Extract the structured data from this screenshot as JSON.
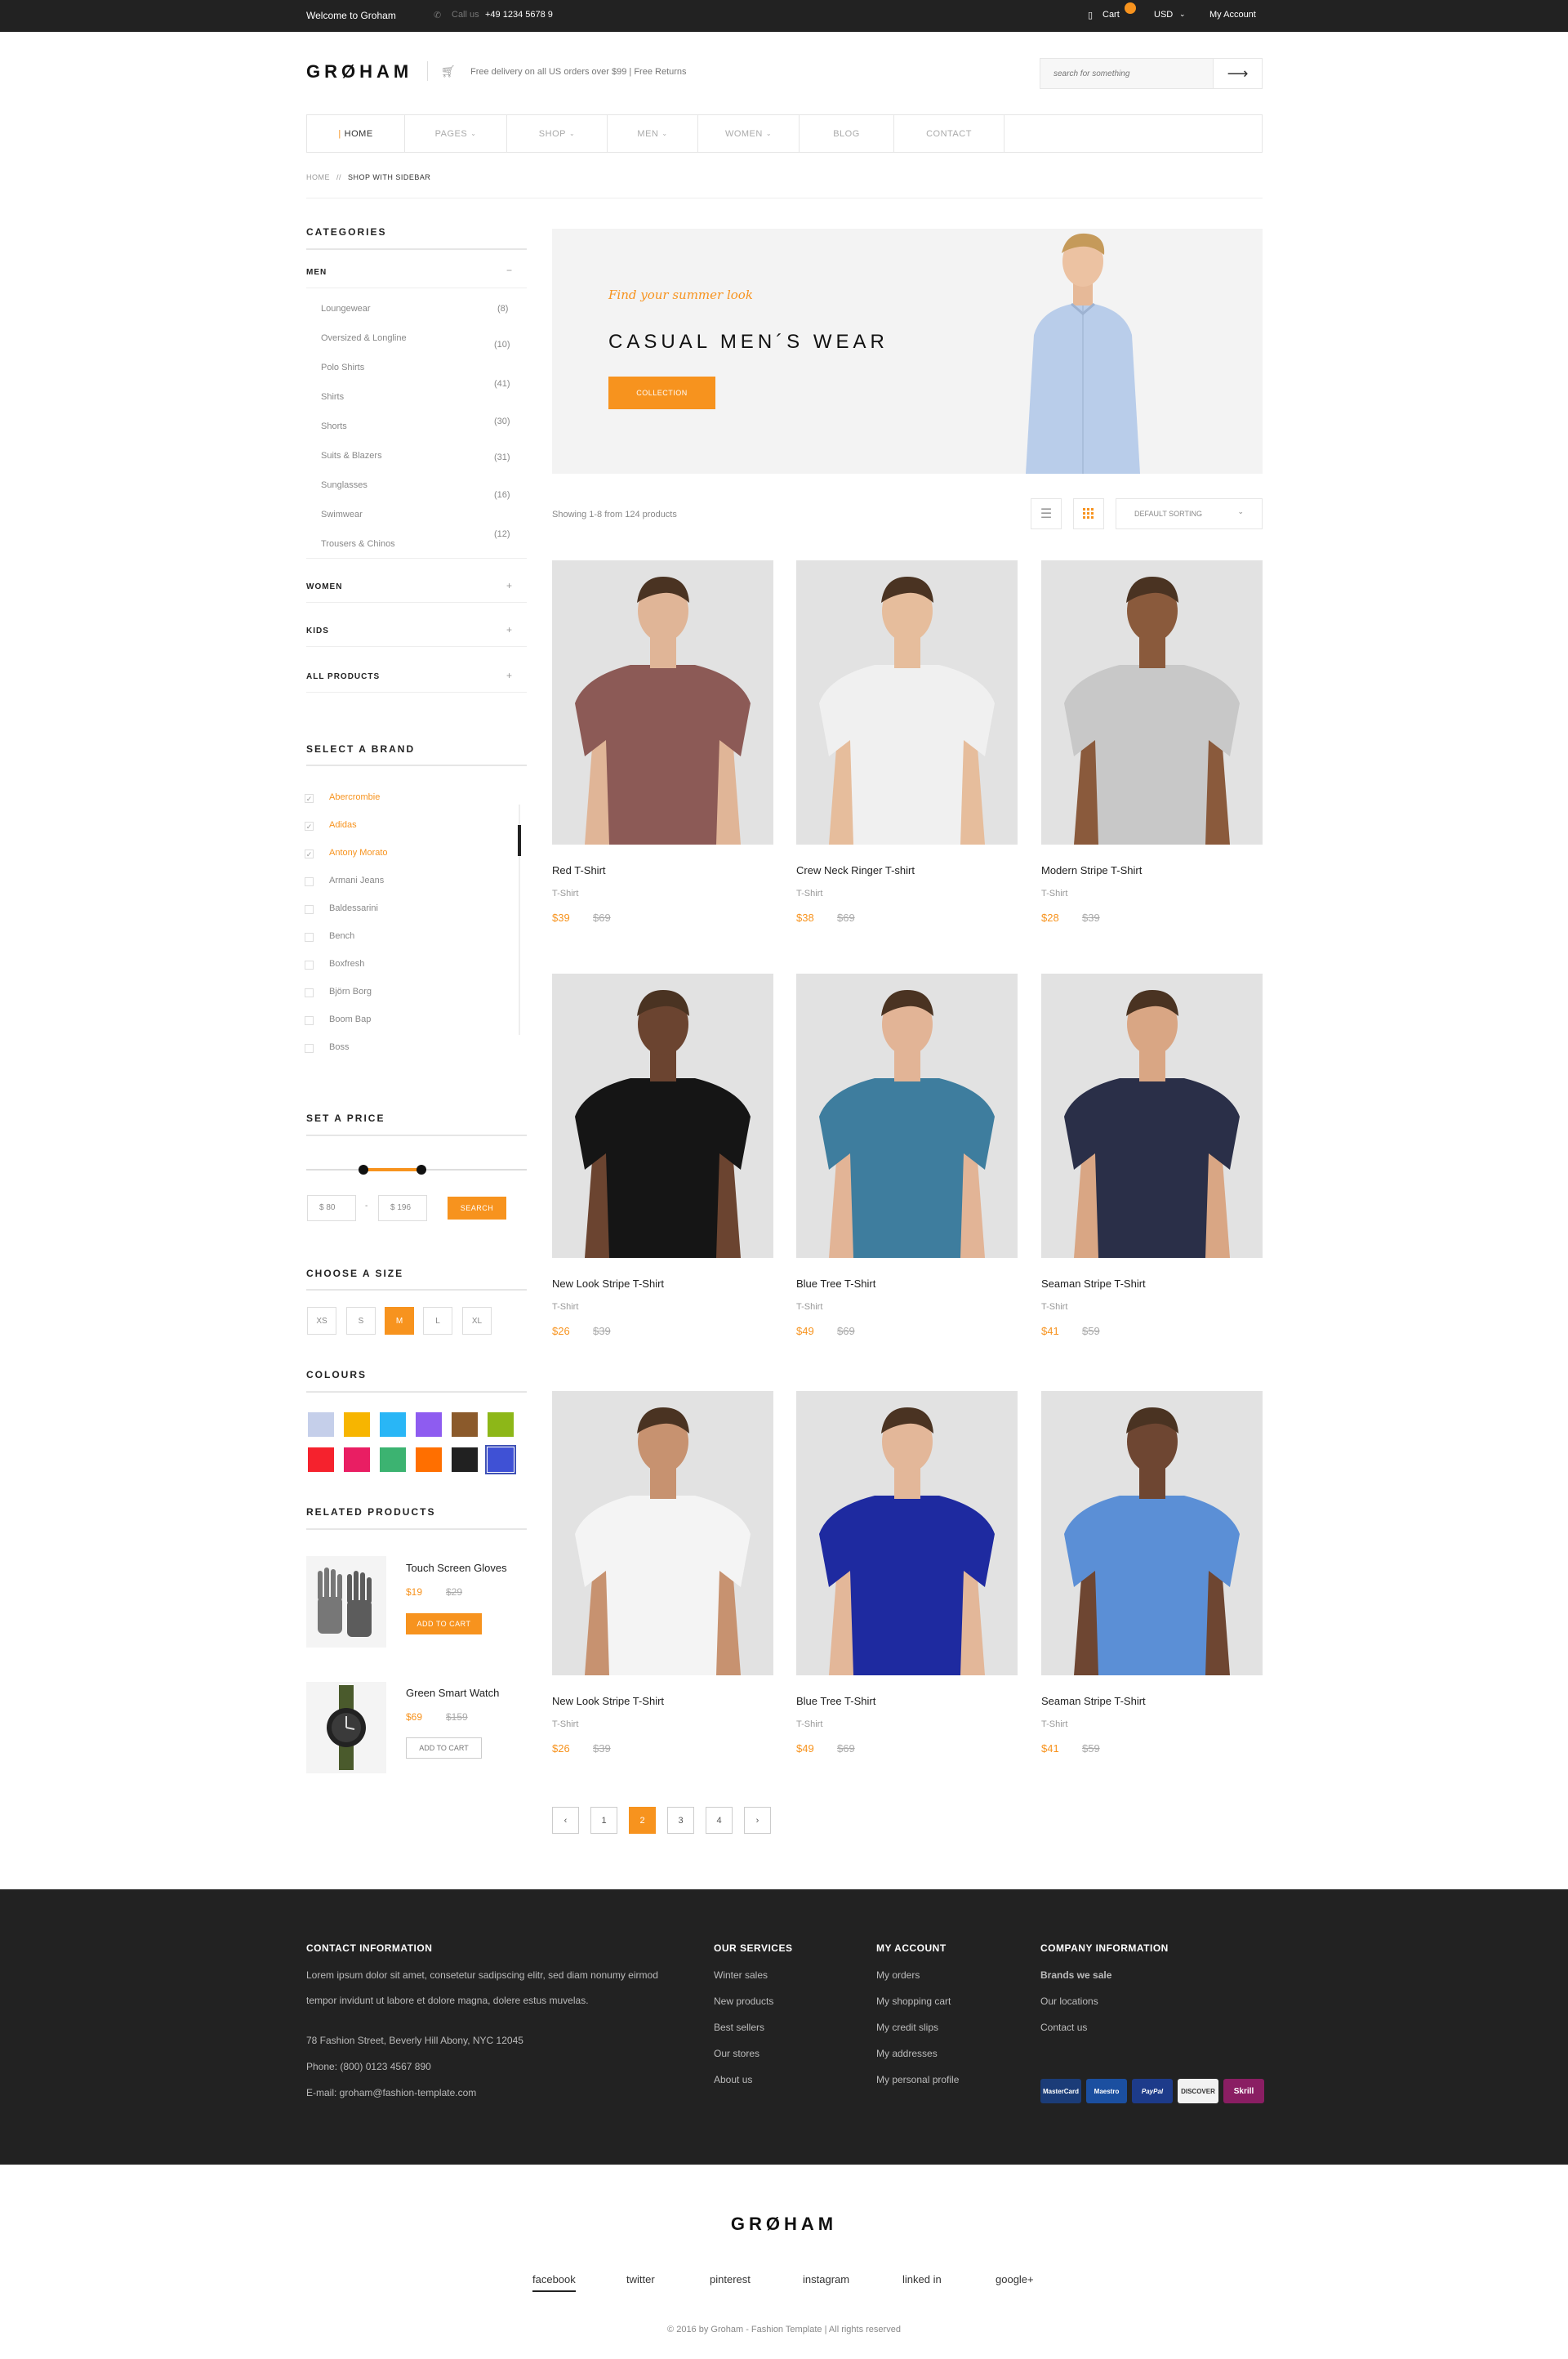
{
  "topbar": {
    "welcome": "Welcome to Groham",
    "call_label": "Call us",
    "phone": "+49 1234 5678 9",
    "cart": "Cart",
    "currency": "USD",
    "account": "My Account"
  },
  "header": {
    "logo": "GRØHAM",
    "delivery": "Free delivery on all US orders over $99 | Free Returns",
    "search_placeholder": "search for something"
  },
  "nav": {
    "items": [
      {
        "label": "HOME"
      },
      {
        "label": "PAGES"
      },
      {
        "label": "SHOP"
      },
      {
        "label": "MEN"
      },
      {
        "label": "WOMEN"
      },
      {
        "label": "BLOG"
      },
      {
        "label": "CONTACT"
      }
    ]
  },
  "breadcrumb": {
    "home": "HOME",
    "sep": "//",
    "current": "SHOP WITH SIDEBAR"
  },
  "sidebar": {
    "categories_title": "CATEGORIES",
    "men": "MEN",
    "men_toggle": "−",
    "subcats": [
      {
        "label": "Loungewear",
        "count": "(8)"
      },
      {
        "label": "Oversized & Longline",
        "count": "(10)"
      },
      {
        "label": "Polo Shirts",
        "count": "(41)"
      },
      {
        "label": "Shirts",
        "count": "(30)"
      },
      {
        "label": "Shorts",
        "count": "(31)"
      },
      {
        "label": "Suits & Blazers",
        "count": "(16)"
      },
      {
        "label": "Sunglasses",
        "count": "(12)"
      },
      {
        "label": "Swimwear",
        "count": ""
      },
      {
        "label": "Trousers & Chinos",
        "count": ""
      }
    ],
    "women": "WOMEN",
    "kids": "KIDS",
    "all_products": "ALL PRODUCTS",
    "plus": "+",
    "brand_title": "SELECT A BRAND",
    "brands": [
      {
        "label": "Abercrombie",
        "checked": "✓"
      },
      {
        "label": "Adidas",
        "checked": "✓"
      },
      {
        "label": "Antony Morato",
        "checked": "✓"
      },
      {
        "label": "Armani Jeans",
        "checked": ""
      },
      {
        "label": "Baldessarini",
        "checked": ""
      },
      {
        "label": "Bench",
        "checked": ""
      },
      {
        "label": "Boxfresh",
        "checked": ""
      },
      {
        "label": "Björn Borg",
        "checked": ""
      },
      {
        "label": "Boom Bap",
        "checked": ""
      },
      {
        "label": "Boss",
        "checked": ""
      }
    ],
    "price_title": "SET A PRICE",
    "price_min": "$  80",
    "price_dash": "-",
    "price_max": "$  196",
    "price_search": "SEARCH",
    "size_title": "CHOOSE A SIZE",
    "sizes": [
      "XS",
      "S",
      "M",
      "L",
      "XL"
    ],
    "colours_title": "COLOURS",
    "colours": [
      "#c5cfea",
      "#f7b500",
      "#29b6f6",
      "#8e5cf0",
      "#8b5a2b",
      "#8db718",
      "#f5222d",
      "#e91e63",
      "#3cb371",
      "#ff6f00",
      "#212121",
      "#3f51d5"
    ],
    "related_title": "RELATED PRODUCTS",
    "related": [
      {
        "name": "Touch Screen Gloves",
        "price": "$19",
        "old": "$29",
        "button": "ADD TO CART"
      },
      {
        "name": "Green Smart Watch",
        "price": "$69",
        "old": "$159",
        "button": "ADD TO CART"
      }
    ]
  },
  "banner": {
    "tagline": "Find your summer look",
    "title": "CASUAL MEN´S WEAR",
    "button": "COLLECTION"
  },
  "toolbar": {
    "showing": "Showing 1-8 from 124 products",
    "sorting": "DEFAULT SORTING"
  },
  "products": [
    {
      "name": "Red T-Shirt",
      "cat": "T-Shirt",
      "price": "$39",
      "old": "$69",
      "shirt": "#8c5a56",
      "skin": "#e0b597"
    },
    {
      "name": "Crew Neck Ringer T-shirt",
      "cat": "T-Shirt",
      "price": "$38",
      "old": "$69",
      "shirt": "#f0f0f0",
      "skin": "#e6bd9c"
    },
    {
      "name": "Modern Stripe T-Shirt",
      "cat": "T-Shirt",
      "price": "$28",
      "old": "$39",
      "shirt": "#c8c8c8",
      "skin": "#8a5a3c"
    },
    {
      "name": "New Look Stripe T-Shirt",
      "cat": "T-Shirt",
      "price": "$26",
      "old": "$39",
      "shirt": "#151515",
      "skin": "#6b4430"
    },
    {
      "name": "Blue Tree T-Shirt",
      "cat": "T-Shirt",
      "price": "$49",
      "old": "$69",
      "shirt": "#3e7d9e",
      "skin": "#e2b496"
    },
    {
      "name": "Seaman Stripe T-Shirt",
      "cat": "T-Shirt",
      "price": "$41",
      "old": "$59",
      "shirt": "#2a2f48",
      "skin": "#d9a684"
    },
    {
      "name": "New Look Stripe T-Shirt",
      "cat": "T-Shirt",
      "price": "$26",
      "old": "$39",
      "shirt": "#f4f4f4",
      "skin": "#c79270"
    },
    {
      "name": "Blue Tree T-Shirt",
      "cat": "T-Shirt",
      "price": "$49",
      "old": "$69",
      "shirt": "#1e2aa0",
      "skin": "#e3b799"
    },
    {
      "name": "Seaman Stripe T-Shirt",
      "cat": "T-Shirt",
      "price": "$41",
      "old": "$59",
      "shirt": "#5b8fd6",
      "skin": "#6e4632"
    }
  ],
  "pagination": {
    "prev": "‹",
    "pages": [
      "1",
      "2",
      "3",
      "4"
    ],
    "next": "›"
  },
  "footer": {
    "contact_title": "CONTACT INFORMATION",
    "contact_text1": "Lorem ipsum dolor sit amet, consetetur sadipscing elitr, sed diam nonumy eirmod",
    "contact_text2": "tempor invidunt ut labore et dolore magna, dolere estus muvelas.",
    "address": "78 Fashion Street, Beverly Hill Abony, NYC 12045",
    "phone": "Phone: (800) 0123 4567 890",
    "email": "E-mail:  groham@fashion-template.com",
    "services_title": "OUR SERVICES",
    "services": [
      "Winter sales",
      "New products",
      "Best sellers",
      "Our stores",
      "About us"
    ],
    "account_title": "MY ACCOUNT",
    "account": [
      "My orders",
      "My shopping cart",
      "My credit slips",
      "My addresses",
      "My personal profile"
    ],
    "company_title": "COMPANY INFORMATION",
    "company": [
      "Brands we sale",
      "Our locations",
      "Contact us"
    ],
    "payments": [
      "MasterCard",
      "Maestro",
      "PayPal",
      "DISCOVER",
      "Skrill"
    ]
  },
  "bottom": {
    "logo": "GRØHAM",
    "social": [
      "facebook",
      "twitter",
      "pinterest",
      "instagram",
      "linked in",
      "google+"
    ],
    "copyright": "© 2016 by Groham - Fashion Template | All rights reserved"
  }
}
